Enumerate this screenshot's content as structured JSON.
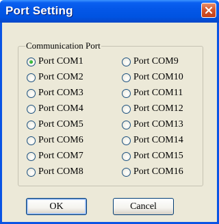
{
  "window": {
    "title": "Port Setting"
  },
  "group": {
    "label": "Communication Port"
  },
  "ports_left": [
    {
      "label": "Port COM1",
      "checked": true
    },
    {
      "label": "Port COM2",
      "checked": false
    },
    {
      "label": "Port COM3",
      "checked": false
    },
    {
      "label": "Port COM4",
      "checked": false
    },
    {
      "label": "Port COM5",
      "checked": false
    },
    {
      "label": "Port COM6",
      "checked": false
    },
    {
      "label": "Port COM7",
      "checked": false
    },
    {
      "label": "Port COM8",
      "checked": false
    }
  ],
  "ports_right": [
    {
      "label": "Port COM9",
      "checked": false
    },
    {
      "label": "Port COM10",
      "checked": false
    },
    {
      "label": "Port COM11",
      "checked": false
    },
    {
      "label": "Port COM12",
      "checked": false
    },
    {
      "label": "Port COM13",
      "checked": false
    },
    {
      "label": "Port COM14",
      "checked": false
    },
    {
      "label": "Port COM15",
      "checked": false
    },
    {
      "label": "Port COM16",
      "checked": false
    }
  ],
  "buttons": {
    "ok_label": "OK",
    "cancel_label": "Cancel"
  },
  "icons": {
    "close": "close-icon",
    "radio": "radio-icon"
  },
  "colors": {
    "titlebar": "#0053e1",
    "close_button": "#d4572e",
    "dialog_background": "#ece9d8",
    "radio_selected": "#21a121"
  }
}
